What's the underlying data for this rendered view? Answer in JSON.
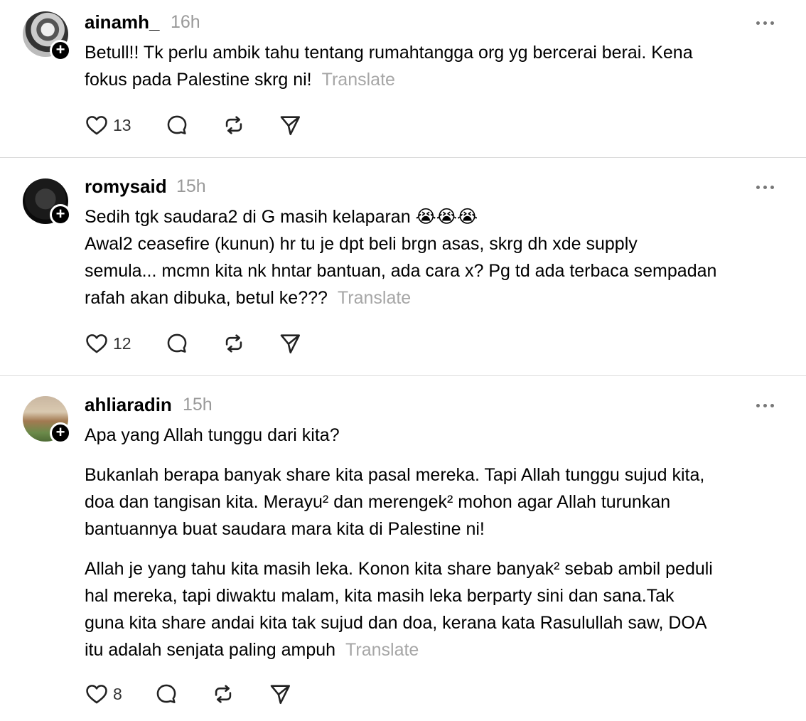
{
  "translate_label": "Translate",
  "comments": [
    {
      "username": "ainamh_",
      "time": "16h",
      "lines": [
        "Betull!! Tk perlu ambik tahu tentang rumahtangga org yg bercerai berai. Kena",
        "fokus pada Palestine skrg ni!"
      ],
      "likes": "13"
    },
    {
      "username": "romysaid",
      "time": "15h",
      "lines": [
        "Sedih tgk saudara2 di G masih kelaparan 😭😭😭",
        "Awal2 ceasefire (kunun) hr tu je dpt beli brgn asas, skrg dh xde supply",
        "semula... mcmn kita nk hntar bantuan, ada cara x? Pg td ada terbaca sempadan",
        "rafah akan dibuka, betul ke???"
      ],
      "likes": "12"
    },
    {
      "username": "ahliaradin",
      "time": "15h",
      "para1": "Apa yang Allah tunggu dari kita?",
      "para2": [
        "Bukanlah berapa banyak share kita pasal mereka. Tapi Allah tunggu sujud kita,",
        "doa dan tangisan kita. Merayu² dan merengek² mohon agar Allah turunkan",
        "bantuannya buat saudara mara kita di Palestine ni!"
      ],
      "para3": [
        "Allah je yang tahu kita masih leka. Konon kita share banyak² sebab ambil peduli",
        "hal mereka, tapi diwaktu malam, kita masih leka berparty sini dan sana.Tak",
        "guna kita share andai kita tak sujud dan doa, kerana kata Rasulullah saw, DOA",
        "itu adalah senjata paling ampuh"
      ],
      "likes": "8"
    }
  ]
}
